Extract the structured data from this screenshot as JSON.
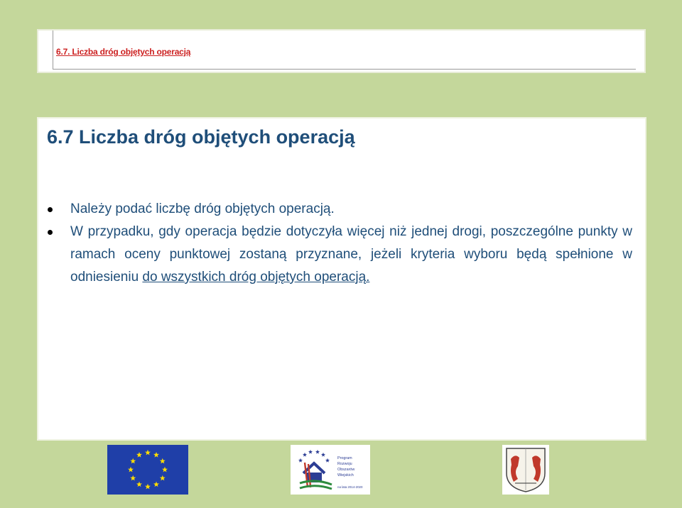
{
  "header_strip": {
    "caption": "6.7. Liczba dróg objętych operacją"
  },
  "slide": {
    "title": "6.7 Liczba dróg objętych operacją",
    "bullet1": "Należy podać liczbę dróg objętych operacją.",
    "bullet2_part1": "W przypadku, gdy operacja będzie dotyczyła więcej niż jednej drogi, poszczególne punkty w ramach oceny punktowej zostaną przyznane, jeżeli kryteria wyboru będą spełnione w odniesieniu ",
    "bullet2_underlined": "do wszystkich dróg objętych operacją."
  },
  "logos": {
    "eu": "eu-flag-icon",
    "prow": {
      "icon": "prow-logo-icon",
      "lines": [
        "Program",
        "Rozwoju",
        "Obszarów",
        "Wiejskich",
        "na lata 2014-2020"
      ]
    },
    "region": "region-coat-of-arms-icon"
  },
  "colors": {
    "background": "#c4d79b",
    "title": "#1f4e79",
    "caption": "#cc2020",
    "eu_blue": "#1f3fa8",
    "eu_stars": "#ffdd00"
  }
}
